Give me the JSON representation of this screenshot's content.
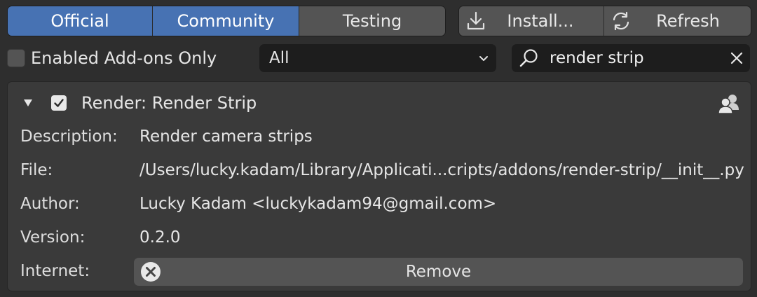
{
  "tabs": [
    {
      "label": "Official",
      "active": true
    },
    {
      "label": "Community",
      "active": true
    },
    {
      "label": "Testing",
      "active": false
    }
  ],
  "actions": {
    "install_label": "Install...",
    "refresh_label": "Refresh"
  },
  "filters": {
    "enabled_only_label": "Enabled Add-ons Only",
    "enabled_only_checked": false,
    "category_value": "All",
    "search_value": "render strip"
  },
  "addon": {
    "title": "Render: Render Strip",
    "enabled": true,
    "expanded": true,
    "fields": {
      "description": {
        "label": "Description:",
        "value": "Render camera strips"
      },
      "file": {
        "label": "File:",
        "value": "/Users/lucky.kadam/Library/Applicati...cripts/addons/render-strip/__init__.py"
      },
      "author": {
        "label": "Author:",
        "value": "Lucky Kadam <luckykadam94@gmail.com>"
      },
      "version": {
        "label": "Version:",
        "value": "0.2.0"
      },
      "internet": {
        "label": "Internet:"
      }
    },
    "remove_label": "Remove"
  },
  "colors": {
    "accent": "#4772b3",
    "background": "#2e2e2e",
    "panel": "#3a3a3a",
    "button": "#545454",
    "field": "#1d1d1d"
  },
  "icons": [
    "import-icon",
    "refresh-icon",
    "chevron-down-icon",
    "search-icon",
    "close-icon",
    "disclosure-triangle-icon",
    "checkmark-icon",
    "community-user-icon",
    "cancel-circle-icon"
  ]
}
